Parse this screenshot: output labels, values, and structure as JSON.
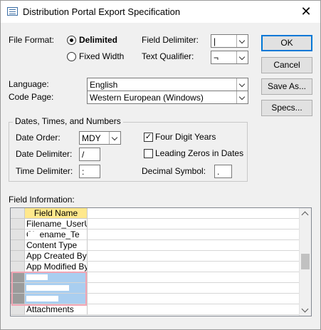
{
  "window": {
    "title": "Distribution Portal Export Specification",
    "close_glyph": "✕"
  },
  "file_format": {
    "label": "File Format:",
    "delimited_label": "Delimited",
    "fixed_width_label": "Fixed Width",
    "selected": "Delimited"
  },
  "field_delimiter": {
    "label": "Field Delimiter:",
    "value": "|"
  },
  "text_qualifier": {
    "label": "Text Qualifier:",
    "value": "¬"
  },
  "language": {
    "label": "Language:",
    "value": "English"
  },
  "code_page": {
    "label": "Code Page:",
    "value": "Western European (Windows)"
  },
  "buttons": {
    "ok": "OK",
    "cancel": "Cancel",
    "save_as": "Save As...",
    "specs": "Specs..."
  },
  "dates": {
    "group_title": "Dates, Times, and Numbers",
    "date_order_label": "Date Order:",
    "date_order_value": "MDY",
    "date_delimiter_label": "Date Delimiter:",
    "date_delimiter_value": "/",
    "time_delimiter_label": "Time Delimiter:",
    "time_delimiter_value": ":",
    "four_digit_years_label": "Four Digit Years",
    "four_digit_years_checked": true,
    "check_glyph": "✓",
    "leading_zeros_label": "Leading Zeros in Dates",
    "leading_zeros_checked": false,
    "decimal_symbol_label": "Decimal Symbol:",
    "decimal_symbol_value": "."
  },
  "field_info": {
    "label": "Field Information:",
    "column_header": "Field Name",
    "rows": [
      {
        "name": "Filename_UserUp",
        "highlighted": false
      },
      {
        "name": "Ch      ename_Te",
        "highlighted": false
      },
      {
        "name": "Content Type",
        "highlighted": false
      },
      {
        "name": "App Created By",
        "highlighted": false
      },
      {
        "name": "App Modified By",
        "highlighted": false
      },
      {
        "name": "",
        "highlighted": true
      },
      {
        "name": "",
        "highlighted": true
      },
      {
        "name": "",
        "highlighted": true
      },
      {
        "name": "Attachments",
        "highlighted": false
      }
    ]
  }
}
